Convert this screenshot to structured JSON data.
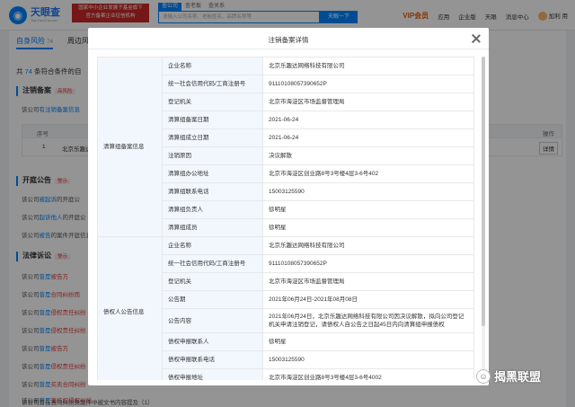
{
  "header": {
    "logo_name": "天眼查",
    "logo_sub": "TianYanCha.com",
    "promo_line1": "国家中小企业发展子基金旗下",
    "promo_line2": "官方备案企业征信机构",
    "search_tabs": [
      "查公司",
      "查老板",
      "查关系"
    ],
    "search_placeholder": "请输入公司名称、老板姓名、品牌名称等",
    "search_button": "天眼一下",
    "nav": {
      "vip": "VIP会员",
      "app": "应用",
      "enterprise": "企业版",
      "tianyan": "天眼",
      "school": "天眼云",
      "messages": "消息中心",
      "user": "加利 用"
    }
  },
  "page": {
    "tabs": [
      {
        "label": "自身风险",
        "count": "74"
      },
      {
        "label": "周边风"
      }
    ],
    "summary_prefix": "共",
    "summary_num": "74",
    "summary_suffix": "条符合条件的自",
    "sections": {
      "cancel": {
        "title": "注销备案",
        "badge": "高风险"
      },
      "open": {
        "title": "开庭公告",
        "badge": "警示"
      },
      "legal": {
        "title": "法律诉讼",
        "badge": "警示"
      }
    },
    "cancel_line_prefix": "该公司",
    "cancel_line_link": "有注销备案信息",
    "table_head": {
      "col1": "序号",
      "col_op": "操作"
    },
    "table_row": {
      "idx": "1",
      "name": "北京乐趣达",
      "op": "详情"
    },
    "open_lines": [
      {
        "prefix": "该公司",
        "link": "被起诉",
        "rest": "的开庭公"
      },
      {
        "prefix": "该公司",
        "link": "起诉他人",
        "rest": "的开庭公"
      },
      {
        "prefix": "该公司",
        "link": "被告",
        "rest": "的案件开庭信息"
      }
    ],
    "legal_lines": [
      {
        "prefix": "该公司",
        "link": "曾是",
        "rest": "被告方"
      },
      {
        "prefix": "该公司",
        "link": "曾是",
        "rest": "合同纠纷而"
      },
      {
        "prefix": "该公司",
        "link": "曾是",
        "rest": "侵权责任纠纷"
      },
      {
        "prefix": "该公司",
        "link": "曾是",
        "rest": "侵权责任纠纷"
      },
      {
        "prefix": "该公司",
        "link": "曾是",
        "rest": "被告方"
      },
      {
        "prefix": "该公司",
        "link": "曾是",
        "rest": "侵权责任纠纷"
      },
      {
        "prefix": "该公司",
        "link": "曾是",
        "rest": "买卖合同纠纷"
      },
      {
        "prefix": "该公司",
        "link": "曾是",
        "rest": "著作权侵权纠纷"
      }
    ],
    "bottom_line": "该公司曾在合同纠纷类案件中被文书内容提及（1）"
  },
  "modal": {
    "title": "注销备案详情",
    "groups": [
      {
        "name": "清算组备案信息",
        "rows": [
          {
            "label": "企业名称",
            "value": "北京乐趣达网络科技有限公司"
          },
          {
            "label": "统一社会信用代码/工商注册号",
            "value": "91110108057390652P"
          },
          {
            "label": "登记机关",
            "value": "北京市海淀区市场监督管理局"
          },
          {
            "label": "清算组备案日期",
            "value": "2021-06-24"
          },
          {
            "label": "清算组成立日期",
            "value": "2021-06-24"
          },
          {
            "label": "注销原因",
            "value": "决议解散"
          },
          {
            "label": "清算组办公地址",
            "value": "北京市海淀区创业路8号3号楼4层3-6号402"
          },
          {
            "label": "清算组联系电话",
            "value": "15003125590"
          },
          {
            "label": "清算组负责人",
            "value": "徐明星"
          },
          {
            "label": "清算组成员",
            "value": "徐明星"
          }
        ]
      },
      {
        "name": "债权人公告信息",
        "rows": [
          {
            "label": "企业名称",
            "value": "北京乐趣达网络科技有限公司"
          },
          {
            "label": "统一社会信用代码/工商注册号",
            "value": "91110108057390652P"
          },
          {
            "label": "登记机关",
            "value": "北京市海淀区市场监督管理局"
          },
          {
            "label": "公告期",
            "value": "2021年06月24日-2021年08月08日"
          },
          {
            "label": "公告内容",
            "value": "2021年06月24日，北京乐趣达网络科技有限公司因决议解散，拟向公司登记机关申请注销登记，请债权人自公告之日起45日内向清算组申报债权"
          },
          {
            "label": "债权申报联系人",
            "value": "徐明星"
          },
          {
            "label": "债权申报联系电话",
            "value": "15003125590"
          },
          {
            "label": "债权申报地址",
            "value": "北京市海淀区创业路8号3号楼4层3-6号4002"
          }
        ]
      }
    ]
  },
  "watermark": "揭黑联盟"
}
